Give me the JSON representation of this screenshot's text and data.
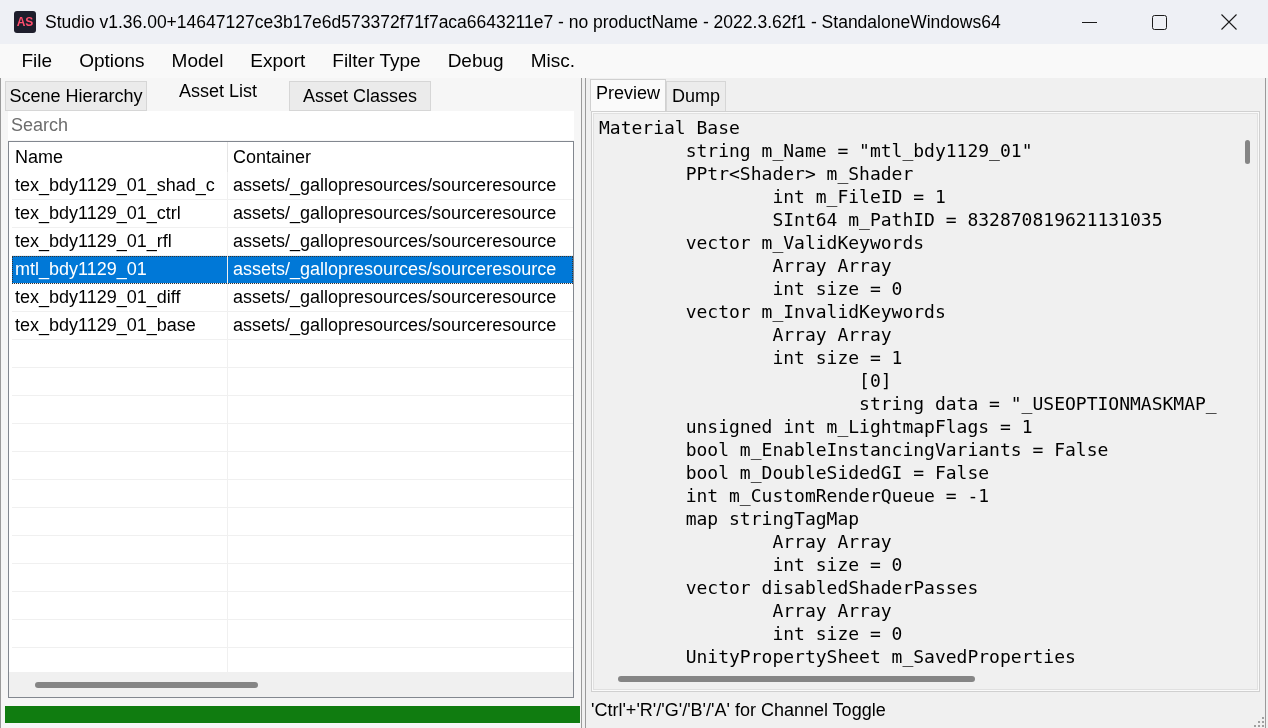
{
  "window": {
    "logo_text": "AS",
    "title": "Studio v1.36.00+14647127ce3b17e6d573372f71f7aca6643211e7 - no productName - 2022.3.62f1 - StandaloneWindows64"
  },
  "menu_bar": [
    "File",
    "Options",
    "Model",
    "Export",
    "Filter Type",
    "Debug",
    "Misc."
  ],
  "left_panel": {
    "tabs": [
      {
        "label": "Scene Hierarchy",
        "selected": false
      },
      {
        "label": "Asset List",
        "selected": true
      },
      {
        "label": "Asset Classes",
        "selected": false
      }
    ],
    "search": {
      "placeholder": "Search"
    },
    "table": {
      "columns": [
        "Name",
        "Container"
      ],
      "rows": [
        {
          "name": "tex_bdy1129_01_shad_c",
          "container": "assets/_gallopresources/sourceresource",
          "selected": false
        },
        {
          "name": "tex_bdy1129_01_ctrl",
          "container": "assets/_gallopresources/sourceresource",
          "selected": false
        },
        {
          "name": "tex_bdy1129_01_rfl",
          "container": "assets/_gallopresources/sourceresource",
          "selected": false
        },
        {
          "name": "mtl_bdy1129_01",
          "container": "assets/_gallopresources/sourceresource",
          "selected": true
        },
        {
          "name": "tex_bdy1129_01_diff",
          "container": "assets/_gallopresources/sourceresource",
          "selected": false
        },
        {
          "name": "tex_bdy1129_01_base",
          "container": "assets/_gallopresources/sourceresource",
          "selected": false
        }
      ]
    },
    "progress": {
      "level": 1
    }
  },
  "right_panel": {
    "tabs": [
      {
        "label": "Preview",
        "selected": true
      },
      {
        "label": "Dump",
        "selected": false
      }
    ],
    "dump": [
      {
        "text": "Material Base",
        "children": [
          {
            "text": "string m_Name = \"mtl_bdy1129_01\""
          },
          {
            "text": "PPtr<Shader> m_Shader",
            "children": [
              {
                "text": "int m_FileID = 1"
              },
              {
                "text": "SInt64 m_PathID = 832870819621131035"
              }
            ]
          },
          {
            "text": "vector m_ValidKeywords",
            "children": [
              {
                "text": "Array Array"
              },
              {
                "text": "int size = 0"
              }
            ]
          },
          {
            "text": "vector m_InvalidKeywords",
            "children": [
              {
                "text": "Array Array"
              },
              {
                "text": "int size = 1",
                "children": [
                  {
                    "text": "[0]"
                  },
                  {
                    "text": "string data = \"_USEOPTIONMASKMAP_"
                  }
                ]
              }
            ]
          },
          {
            "text": "unsigned int m_LightmapFlags = 1"
          },
          {
            "text": "bool m_EnableInstancingVariants = False"
          },
          {
            "text": "bool m_DoubleSidedGI = False"
          },
          {
            "text": "int m_CustomRenderQueue = -1"
          },
          {
            "text": "map stringTagMap",
            "children": [
              {
                "text": "Array Array"
              },
              {
                "text": "int size = 0"
              }
            ]
          },
          {
            "text": "vector disabledShaderPasses",
            "children": [
              {
                "text": "Array Array"
              },
              {
                "text": "int size = 0"
              }
            ]
          },
          {
            "text": "UnityPropertySheet m_SavedProperties"
          }
        ]
      }
    ],
    "status_bar": "'Ctrl'+'R'/'G'/'B'/'A' for Channel Toggle"
  }
}
